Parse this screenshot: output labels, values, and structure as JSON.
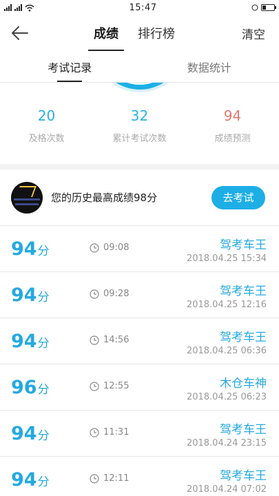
{
  "status": {
    "time": "15:47",
    "wifi_icon": "wifi-icon",
    "battery_icon": "battery-icon"
  },
  "nav": {
    "back_icon": "back-arrow-icon",
    "tabs": [
      {
        "label": "成绩"
      },
      {
        "label": "排行榜"
      }
    ],
    "clear_label": "清空"
  },
  "sub_tabs": [
    {
      "label": "考试记录"
    },
    {
      "label": "数据统计"
    }
  ],
  "stats": [
    {
      "value": "20",
      "label": "及格次数"
    },
    {
      "value": "32",
      "label": "累计考试次数"
    },
    {
      "value": "94",
      "label": "成绩预测"
    }
  ],
  "best": {
    "text": "您的历史最高成绩98分",
    "button": "去考试"
  },
  "records": [
    {
      "score": "94",
      "unit": "分",
      "duration": "09:08",
      "rank": "驾考车王",
      "date": "2018.04.25  15:34"
    },
    {
      "score": "94",
      "unit": "分",
      "duration": "09:28",
      "rank": "驾考车王",
      "date": "2018.04.25  12:16"
    },
    {
      "score": "94",
      "unit": "分",
      "duration": "14:56",
      "rank": "驾考车王",
      "date": "2018.04.25  06:36"
    },
    {
      "score": "96",
      "unit": "分",
      "duration": "12:55",
      "rank": "木仓车神",
      "date": "2018.04.25  06:23"
    },
    {
      "score": "94",
      "unit": "分",
      "duration": "11:31",
      "rank": "驾考车王",
      "date": "2018.04.24  23:15"
    },
    {
      "score": "94",
      "unit": "分",
      "duration": "12:11",
      "rank": "驾考车王",
      "date": "2018.04.24  07:02"
    }
  ],
  "colors": {
    "accent": "#24a9e0",
    "prediction": "#e07b70",
    "button": "#1eaee6"
  }
}
